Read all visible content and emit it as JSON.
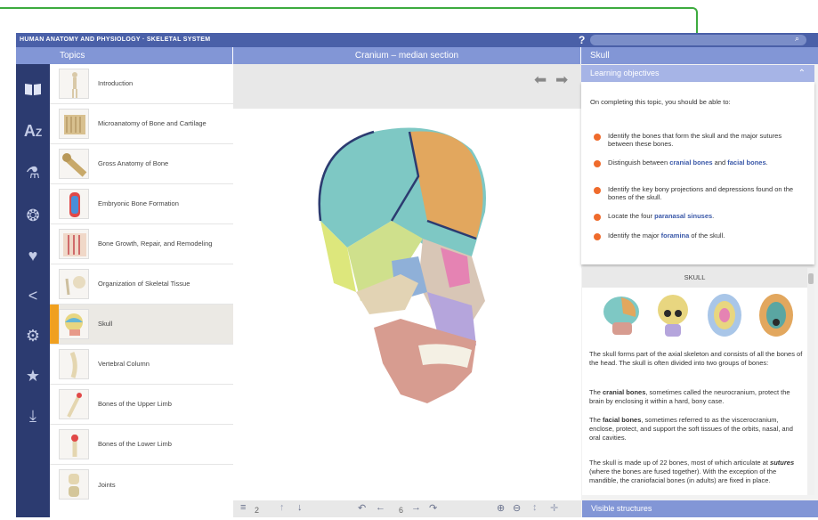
{
  "app": {
    "title": "HUMAN ANATOMY AND PHYSIOLOGY · SKELETAL SYSTEM",
    "help": "?"
  },
  "header": {
    "topics": "Topics",
    "center": "Cranium – median section",
    "right": "Skull"
  },
  "rail": [
    "book-icon",
    "az-icon",
    "flask-icon",
    "lightbulb-icon",
    "heartbeat-icon",
    "share-icon",
    "gear-icon",
    "star-icon",
    "download-icon"
  ],
  "topics": [
    {
      "label": "Introduction"
    },
    {
      "label": "Microanatomy of Bone and Cartilage"
    },
    {
      "label": "Gross Anatomy of Bone"
    },
    {
      "label": "Embryonic Bone Formation"
    },
    {
      "label": "Bone Growth, Repair, and Remodeling"
    },
    {
      "label": "Organization of Skeletal Tissue"
    },
    {
      "label": "Skull"
    },
    {
      "label": "Vertebral Column"
    },
    {
      "label": "Bones of the Upper Limb"
    },
    {
      "label": "Bones of the Lower Limb"
    },
    {
      "label": "Joints"
    }
  ],
  "objectives": {
    "heading": "Learning objectives",
    "intro": "On completing this topic, you should be able to:",
    "items": [
      {
        "a": "Identify the bones that form the skull and the major sutures between these bones."
      },
      {
        "a": "Distinguish between ",
        "b": "cranial bones",
        "c": " and ",
        "d": "facial bones",
        "e": "."
      },
      {
        "a": "Identify the key bony projections and depressions found on the bones of the skull."
      },
      {
        "a": "Locate the four ",
        "b": "paranasal sinuses",
        "c": "."
      },
      {
        "a": "Identify the major ",
        "b": "foramina",
        "c": " of the skull."
      }
    ]
  },
  "skull_card": {
    "title": "SKULL",
    "p1": "The skull forms part of the axial skeleton and consists of all the bones of the head. The skull is often divided into two groups of bones:",
    "p2a": "The ",
    "p2b": "cranial bones",
    "p2c": ", sometimes called the neurocranium, protect the brain by enclosing it within a hard, bony case.",
    "p3a": "The ",
    "p3b": "facial bones",
    "p3c": ", sometimes referred to as the viscerocranium, enclose, protect, and support the soft tissues of the orbits, nasal, and oral cavities.",
    "p4a": "The skull is made up of 22 bones, most of which articulate at ",
    "p4b": "sutures",
    "p4c": " (where the bones are fused together). With the exception of the mandible, the craniofacial bones (in adults) are fixed in place."
  },
  "bottom": {
    "layers": "2",
    "page": "6"
  },
  "visible": "Visible structures"
}
